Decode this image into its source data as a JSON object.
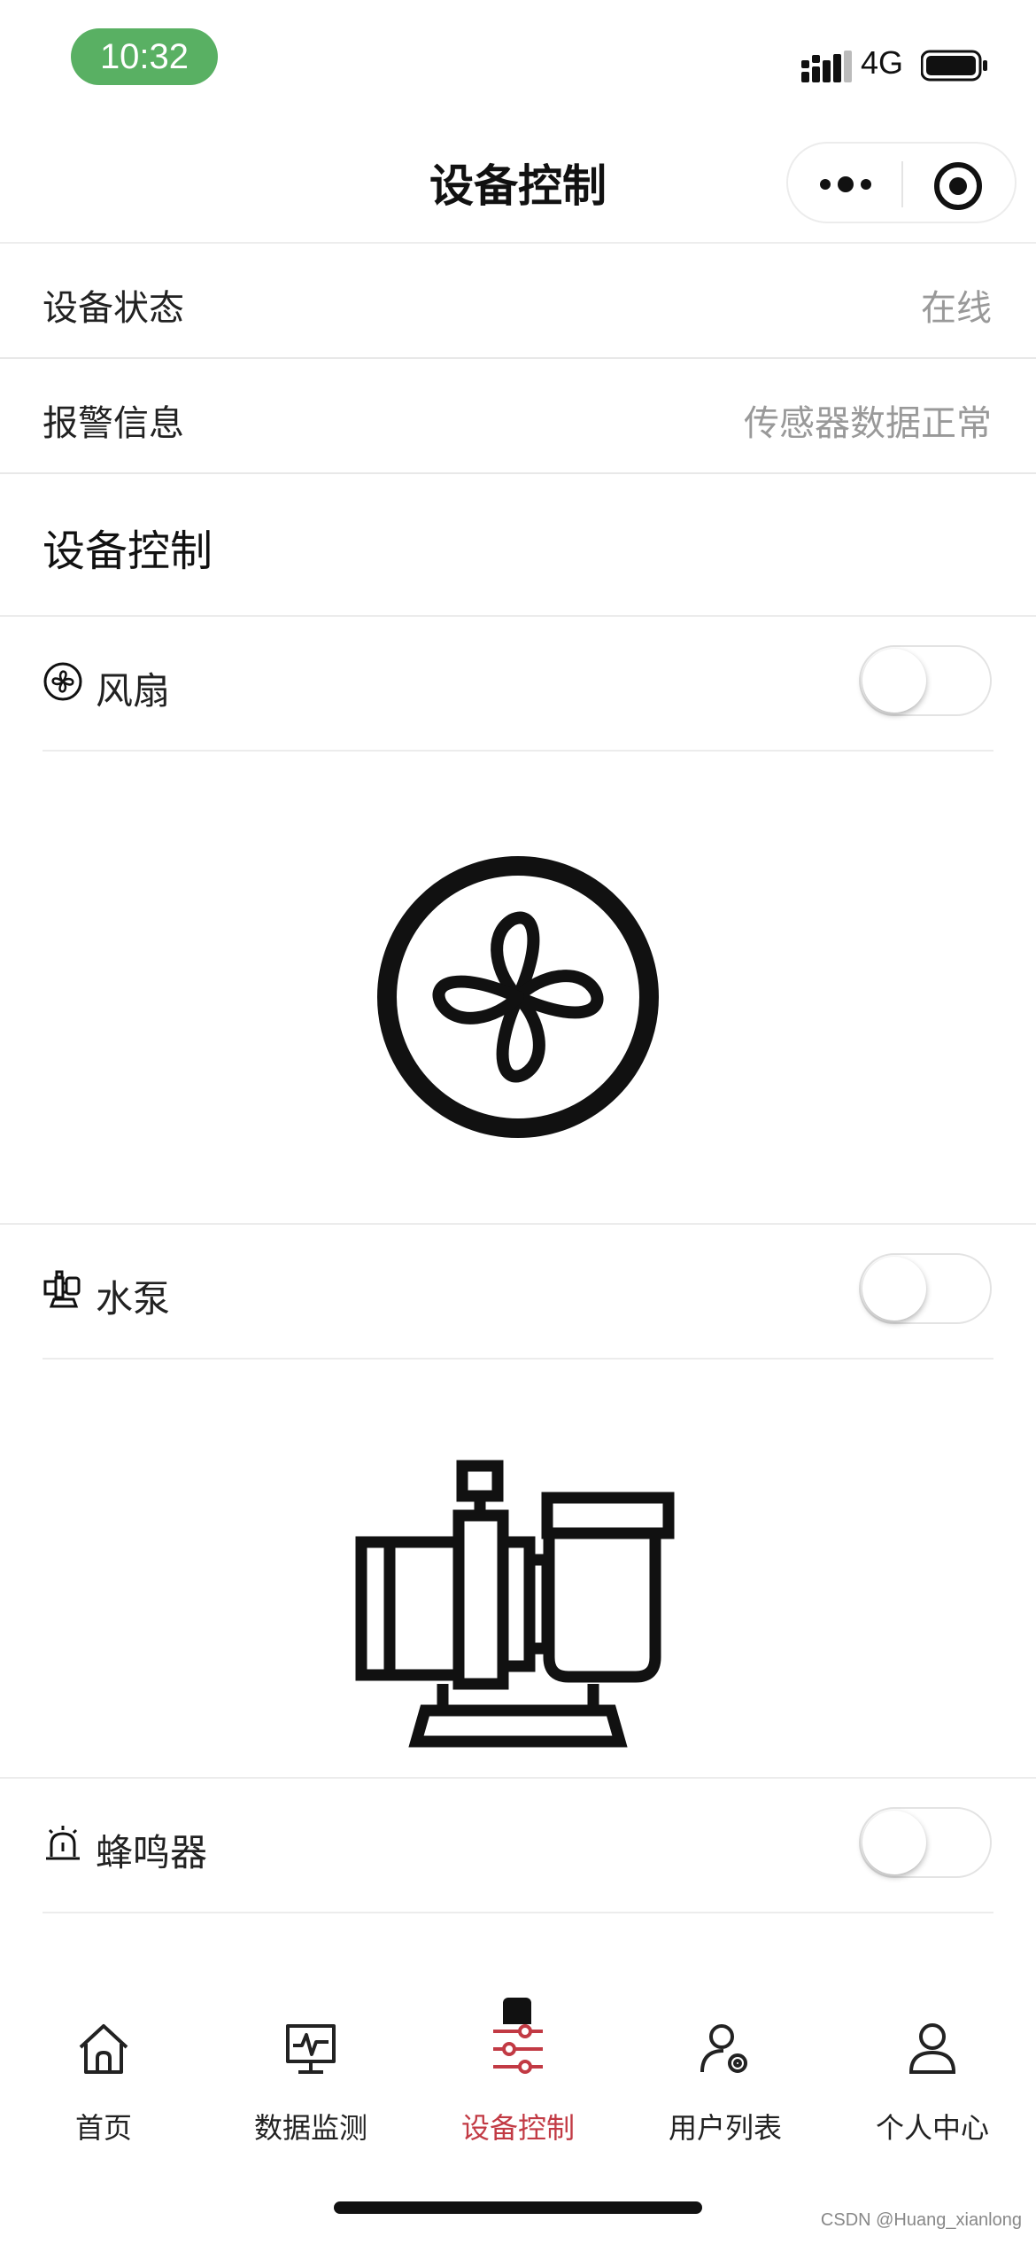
{
  "status_bar": {
    "time": "10:32",
    "network": "4G",
    "time_pill_color": "#59b063"
  },
  "nav": {
    "title": "设备控制",
    "more_icon": "more-dots-icon",
    "target_icon": "target-circle-icon"
  },
  "info": [
    {
      "label": "设备状态",
      "value": "在线"
    },
    {
      "label": "报警信息",
      "value": "传感器数据正常"
    }
  ],
  "control_section": {
    "title": "设备控制"
  },
  "devices": [
    {
      "label": "风扇",
      "icon": "fan-icon",
      "switch_on": false
    },
    {
      "label": "水泵",
      "icon": "water-pump-icon",
      "switch_on": false
    },
    {
      "label": "蜂鸣器",
      "icon": "alarm-buzzer-icon",
      "switch_on": false
    }
  ],
  "tabs": [
    {
      "label": "首页",
      "icon": "home-icon",
      "active": false
    },
    {
      "label": "数据监测",
      "icon": "monitor-pulse-icon",
      "active": false
    },
    {
      "label": "设备控制",
      "icon": "sliders-icon",
      "active": true
    },
    {
      "label": "用户列表",
      "icon": "user-gear-icon",
      "active": false
    },
    {
      "label": "个人中心",
      "icon": "user-icon",
      "active": false
    }
  ],
  "colors": {
    "active_tab": "#c23a44",
    "secondary_text": "#999999"
  },
  "watermark": "CSDN @Huang_xianlong"
}
